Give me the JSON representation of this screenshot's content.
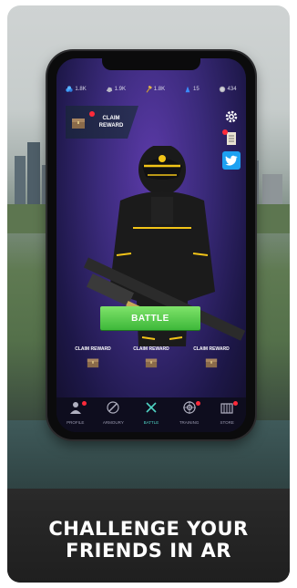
{
  "headline": {
    "line1": "CHALLENGE YOUR",
    "line2": "FRIENDS IN AR"
  },
  "resources": [
    {
      "icon": "gems-icon",
      "value": "1.8K"
    },
    {
      "icon": "ore-icon",
      "value": "1.9K"
    },
    {
      "icon": "hammer-icon",
      "value": "1.8K"
    },
    {
      "icon": "crystal-icon",
      "value": "15"
    },
    {
      "icon": "coin-icon",
      "value": "434"
    }
  ],
  "claim_top": {
    "label": "CLAIM REWARD"
  },
  "side_icons": [
    "gear-icon",
    "scroll-icon",
    "twitter-icon"
  ],
  "battle_button": {
    "label": "BATTLE"
  },
  "slots": [
    {
      "label": "CLAIM REWARD"
    },
    {
      "label": "CLAIM REWARD"
    },
    {
      "label": "CLAIM REWARD"
    }
  ],
  "nav": [
    {
      "label": "PROFILE",
      "icon": "profile-icon",
      "badge": true,
      "active": false
    },
    {
      "label": "ARMOURY",
      "icon": "armoury-icon",
      "badge": false,
      "active": false
    },
    {
      "label": "BATTLE",
      "icon": "battle-icon",
      "badge": false,
      "active": true
    },
    {
      "label": "TRAINING",
      "icon": "training-icon",
      "badge": true,
      "active": false
    },
    {
      "label": "STORE",
      "icon": "store-icon",
      "badge": true,
      "active": false
    }
  ],
  "colors": {
    "accent_green": "#4cc44a",
    "badge_red": "#ff2a3a",
    "active_teal": "#4fd3c4",
    "screen_purple": "#3a2a7a"
  }
}
